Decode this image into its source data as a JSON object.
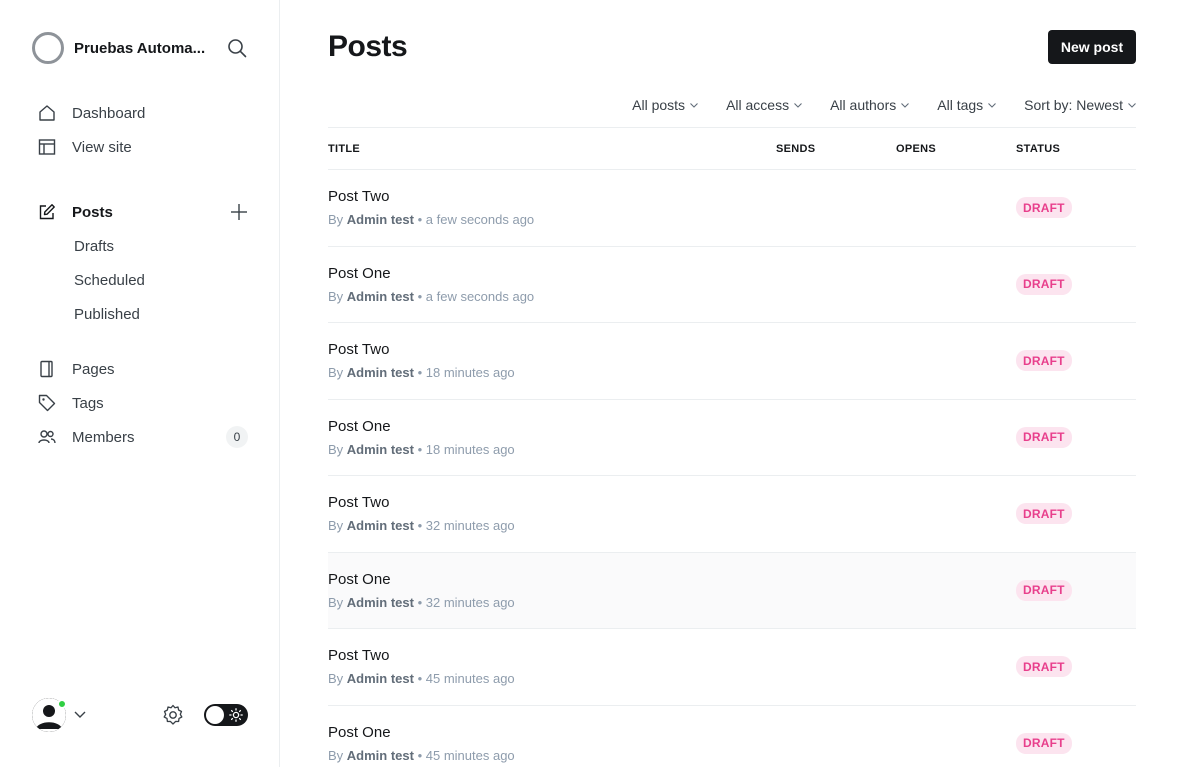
{
  "sidebar": {
    "site_name": "Pruebas Automa...",
    "nav": [
      {
        "label": "Dashboard"
      },
      {
        "label": "View site"
      }
    ],
    "posts": {
      "label": "Posts",
      "sub": [
        "Drafts",
        "Scheduled",
        "Published"
      ]
    },
    "nav2": [
      {
        "label": "Pages"
      },
      {
        "label": "Tags"
      },
      {
        "label": "Members",
        "count": "0"
      }
    ]
  },
  "header": {
    "title": "Posts",
    "new_post_label": "New post"
  },
  "filters": [
    "All posts",
    "All access",
    "All authors",
    "All tags",
    "Sort by: Newest"
  ],
  "table": {
    "columns": [
      "TITLE",
      "SENDS",
      "OPENS",
      "STATUS"
    ],
    "rows": [
      {
        "title": "Post Two",
        "by": "By",
        "author": "Admin test",
        "time": "• a few seconds ago",
        "status": "DRAFT"
      },
      {
        "title": "Post One",
        "by": "By",
        "author": "Admin test",
        "time": "• a few seconds ago",
        "status": "DRAFT"
      },
      {
        "title": "Post Two",
        "by": "By",
        "author": "Admin test",
        "time": "• 18 minutes ago",
        "status": "DRAFT"
      },
      {
        "title": "Post One",
        "by": "By",
        "author": "Admin test",
        "time": "• 18 minutes ago",
        "status": "DRAFT"
      },
      {
        "title": "Post Two",
        "by": "By",
        "author": "Admin test",
        "time": "• 32 minutes ago",
        "status": "DRAFT"
      },
      {
        "title": "Post One",
        "by": "By",
        "author": "Admin test",
        "time": "• 32 minutes ago",
        "status": "DRAFT"
      },
      {
        "title": "Post Two",
        "by": "By",
        "author": "Admin test",
        "time": "• 45 minutes ago",
        "status": "DRAFT"
      },
      {
        "title": "Post One",
        "by": "By",
        "author": "Admin test",
        "time": "• 45 minutes ago",
        "status": "DRAFT"
      }
    ]
  },
  "colors": {
    "draft_text": "#e83f8c",
    "draft_bg": "#fce4ef",
    "primary": "#15171a",
    "online": "#30cf43"
  }
}
